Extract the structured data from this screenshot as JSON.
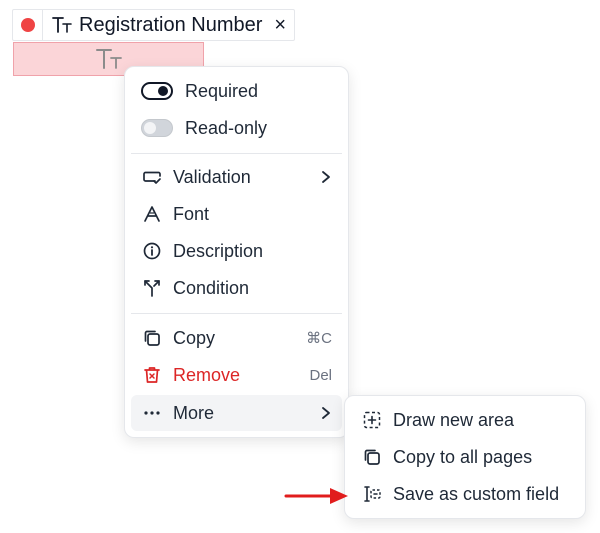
{
  "field": {
    "title": "Registration Number",
    "close": "×",
    "status_color": "#ef4444",
    "area_icon": "text-type-icon"
  },
  "menu": {
    "required": {
      "label": "Required",
      "checked": true
    },
    "readonly": {
      "label": "Read-only",
      "checked": false
    },
    "validation": {
      "label": "Validation",
      "icon": "input-check-icon"
    },
    "font": {
      "label": "Font",
      "icon": "font-icon"
    },
    "description": {
      "label": "Description",
      "icon": "info-circle-icon"
    },
    "condition": {
      "label": "Condition",
      "icon": "branch-icon"
    },
    "copy": {
      "label": "Copy",
      "shortcut": "⌘C",
      "icon": "copy-icon"
    },
    "remove": {
      "label": "Remove",
      "shortcut": "Del",
      "icon": "trash-icon"
    },
    "more": {
      "label": "More",
      "icon": "dots-icon"
    }
  },
  "submenu": {
    "draw": {
      "label": "Draw new area",
      "icon": "draw-area-icon"
    },
    "copy_all": {
      "label": "Copy to all pages",
      "icon": "copy-icon"
    },
    "save_custom": {
      "label": "Save as custom field",
      "icon": "custom-field-icon"
    }
  },
  "colors": {
    "danger": "#dc2626",
    "field_fill": "#fbd5d8",
    "annotation_arrow": "#e11d1d"
  }
}
